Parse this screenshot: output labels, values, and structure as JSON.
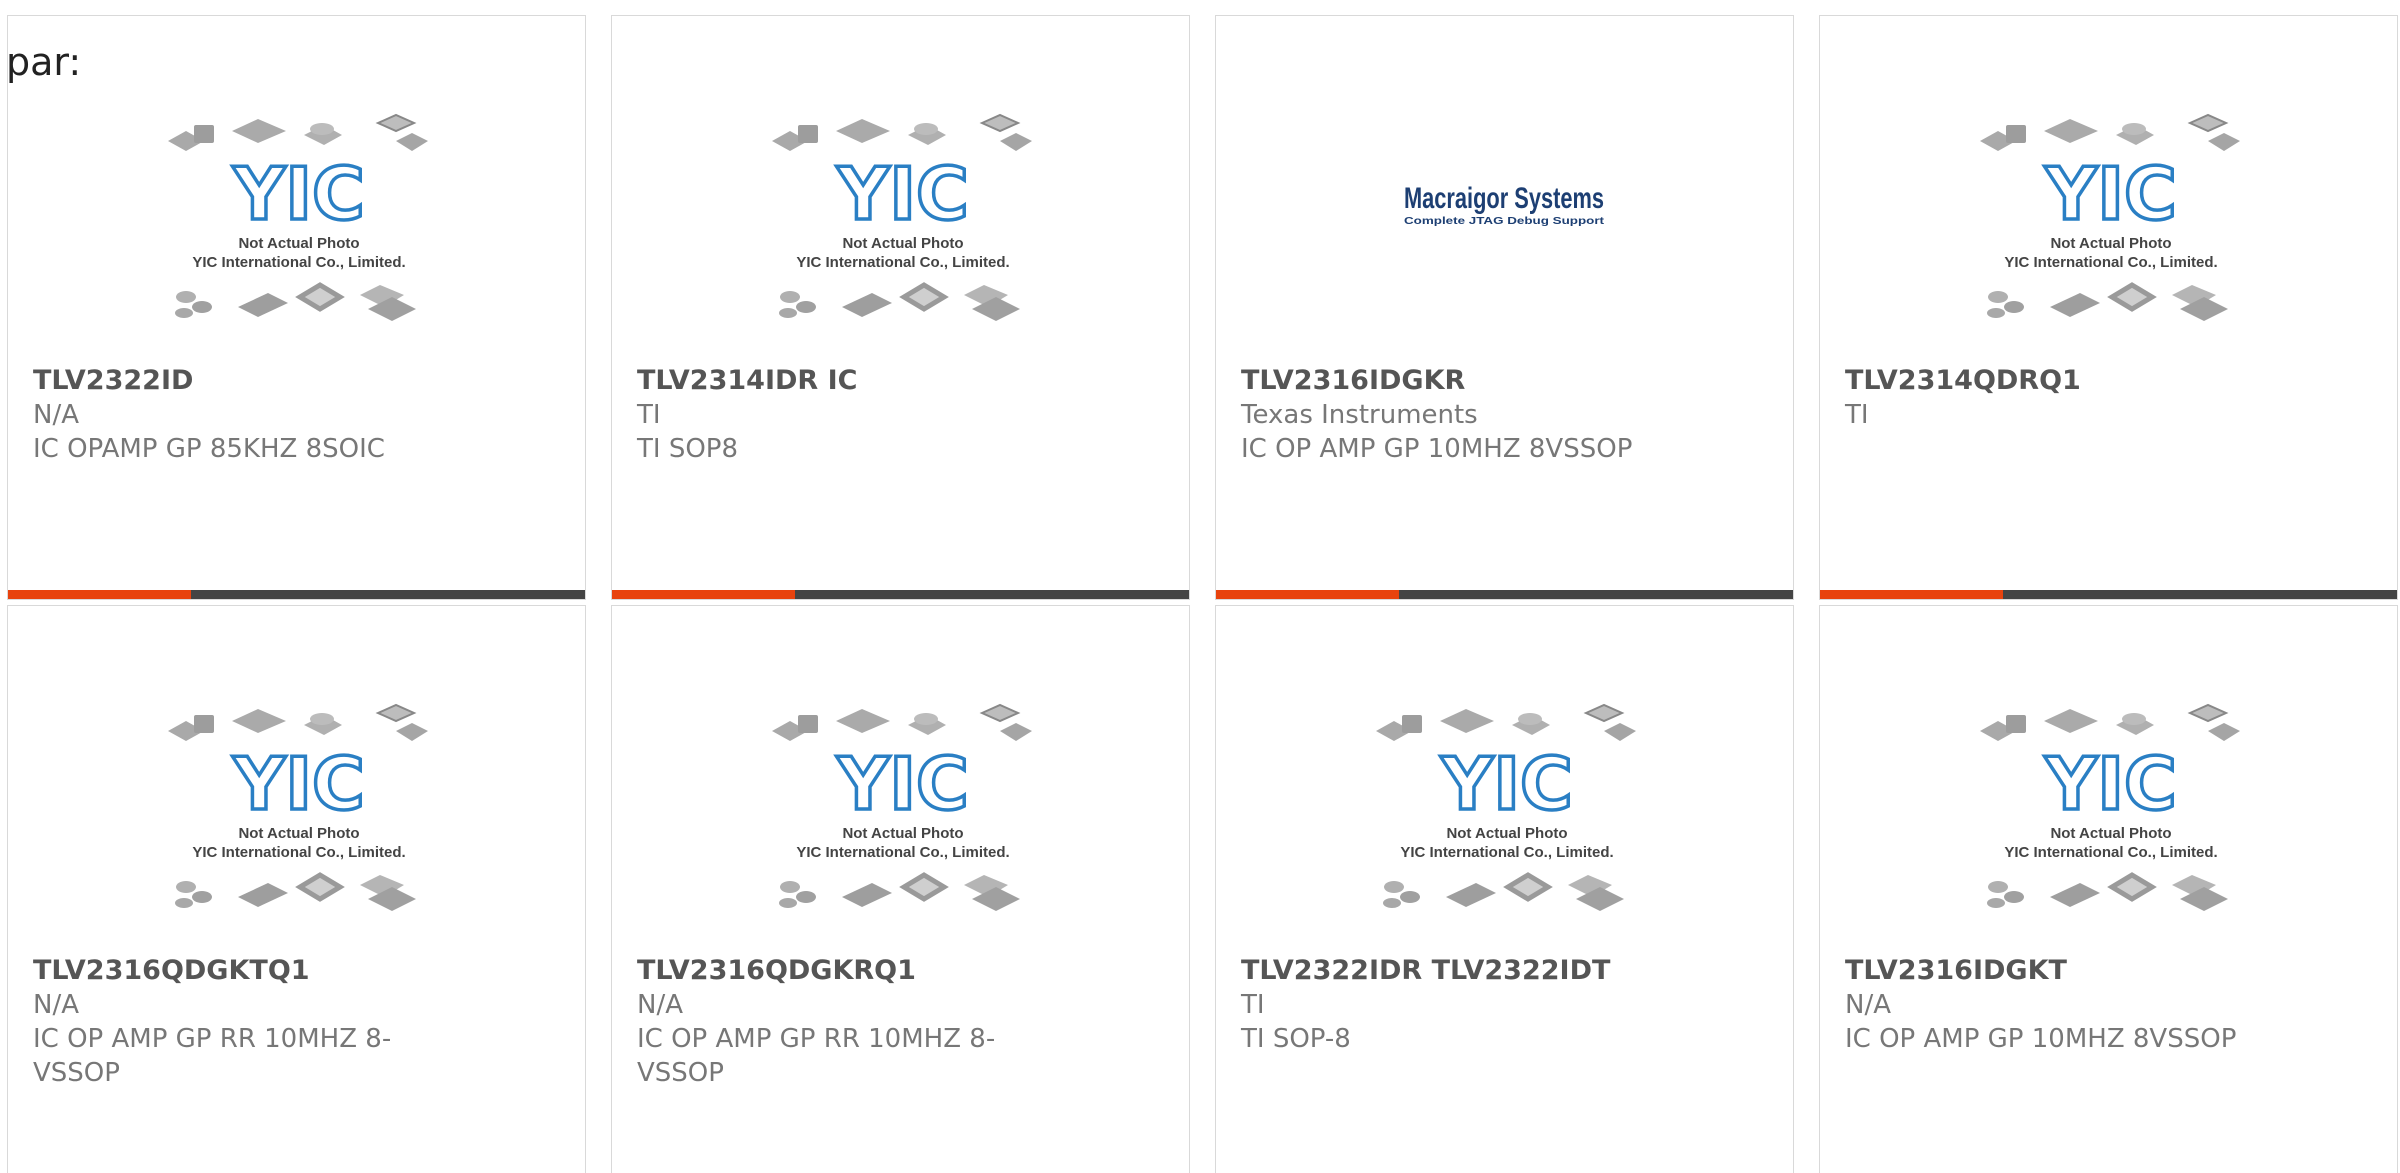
{
  "header_label": "par:",
  "placeholder_image": {
    "caption_line1": "Not Actual Photo",
    "caption_line2": "YIC International Co., Limited.",
    "logo_text": "YIC"
  },
  "colors": {
    "accent": "#e8430e",
    "bar": "#444444",
    "logo_blue": "#2a7fc4"
  },
  "products": [
    {
      "part_number": "TLV2322ID",
      "manufacturer": "N/A",
      "description": "IC OPAMP GP 85KHZ 8SOIC",
      "image": "yic-placeholder"
    },
    {
      "part_number": "TLV2314IDR IC",
      "manufacturer": "TI",
      "description": "TI SOP8",
      "image": "yic-placeholder"
    },
    {
      "part_number": "TLV2316IDGKR",
      "manufacturer": "Texas Instruments",
      "description": "IC OP AMP GP 10MHZ 8VSSOP",
      "image": "macraigor-logo",
      "image_text": {
        "title": "Macraigor Systems",
        "subtitle": "Complete JTAG Debug Support"
      }
    },
    {
      "part_number": "TLV2314QDRQ1",
      "manufacturer": "TI",
      "description": "",
      "image": "yic-placeholder"
    },
    {
      "part_number": "TLV2316QDGKTQ1",
      "manufacturer": "N/A",
      "description": "IC OP AMP GP RR 10MHZ 8-VSSOP",
      "image": "yic-placeholder"
    },
    {
      "part_number": "TLV2316QDGKRQ1",
      "manufacturer": "N/A",
      "description": "IC OP AMP GP RR 10MHZ 8-VSSOP",
      "image": "yic-placeholder"
    },
    {
      "part_number": "TLV2322IDR TLV2322IDT",
      "manufacturer": "TI",
      "description": "TI SOP-8",
      "image": "yic-placeholder"
    },
    {
      "part_number": "TLV2316IDGKT",
      "manufacturer": "N/A",
      "description": "IC OP AMP GP 10MHZ 8VSSOP",
      "image": "yic-placeholder"
    }
  ]
}
